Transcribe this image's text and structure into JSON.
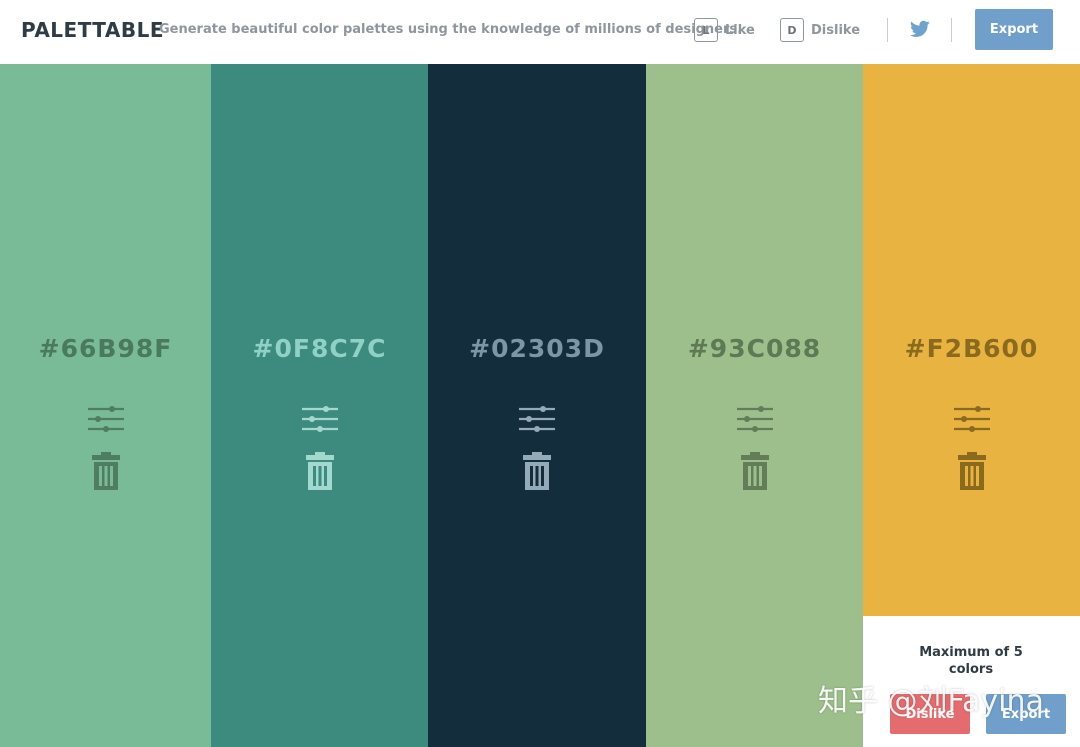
{
  "header": {
    "brand": "PALETTABLE",
    "tagline": "Generate beautiful color palettes using the knowledge of millions of designers.",
    "like_key": "L",
    "like_label": "Like",
    "dislike_key": "D",
    "dislike_label": "Dislike",
    "twitter_icon": "twitter-icon",
    "export_label": "Export"
  },
  "palette": [
    {
      "hex": "#66B98F",
      "color": "#79bb96",
      "text_color": "#4a7a5e",
      "icon_color": "#4f7d62"
    },
    {
      "hex": "#0F8C7C",
      "color": "#3d8a7e",
      "text_color": "#8fd1c4",
      "icon_color": "#a3d8cf"
    },
    {
      "hex": "#02303D",
      "color": "#132d3d",
      "text_color": "#7d96a6",
      "icon_color": "#94aab8"
    },
    {
      "hex": "#93C088",
      "color": "#9dbf8c",
      "text_color": "#5e7a55",
      "icon_color": "#627d58"
    },
    {
      "hex": "#F2B600",
      "color": "#e8b341",
      "text_color": "#8a6a1c",
      "icon_color": "#8a6a1c"
    }
  ],
  "icons": {
    "adjust": "sliders-icon",
    "delete": "trash-icon"
  },
  "panel": {
    "message": "Maximum of 5 colors",
    "dislike_label": "Dislike",
    "export_label": "Export"
  },
  "watermark": "知乎 @刘Fayina"
}
